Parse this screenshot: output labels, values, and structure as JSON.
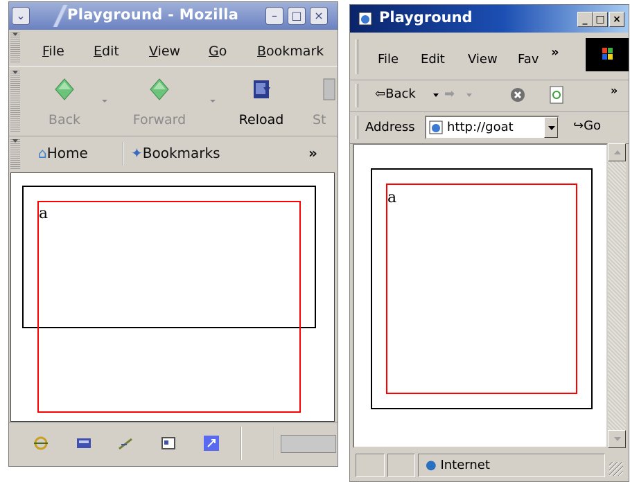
{
  "mozilla": {
    "title": "Playground - Mozilla",
    "menus": [
      {
        "first": "F",
        "rest": "ile"
      },
      {
        "first": "E",
        "rest": "dit"
      },
      {
        "first": "V",
        "rest": "iew"
      },
      {
        "first": "G",
        "rest": "o"
      },
      {
        "first": "B",
        "rest": "ookmark"
      }
    ],
    "nav": {
      "back": "Back",
      "forward": "Forward",
      "reload": "Reload",
      "stop": "St"
    },
    "personal": {
      "home": "Home",
      "bookmarks": "Bookmarks",
      "more": "»"
    },
    "content": {
      "text": "a"
    },
    "system_buttons": {
      "minimize": "–",
      "maximize": "□",
      "close": "×",
      "menu": "⌄"
    }
  },
  "ie": {
    "title": "Playground",
    "menus": [
      "File",
      "Edit",
      "View",
      "Fav",
      "»"
    ],
    "toolbar": {
      "back": "Back",
      "more": "»"
    },
    "address": {
      "label": "Address",
      "value": "http://goat",
      "go": "Go"
    },
    "content": {
      "text": "a"
    },
    "status": {
      "zone": "Internet"
    },
    "system_buttons": {
      "minimize": "_",
      "maximize": "□",
      "close": "×"
    }
  },
  "colors": {
    "black_box": "#000000",
    "red_box": "#ff0000"
  }
}
